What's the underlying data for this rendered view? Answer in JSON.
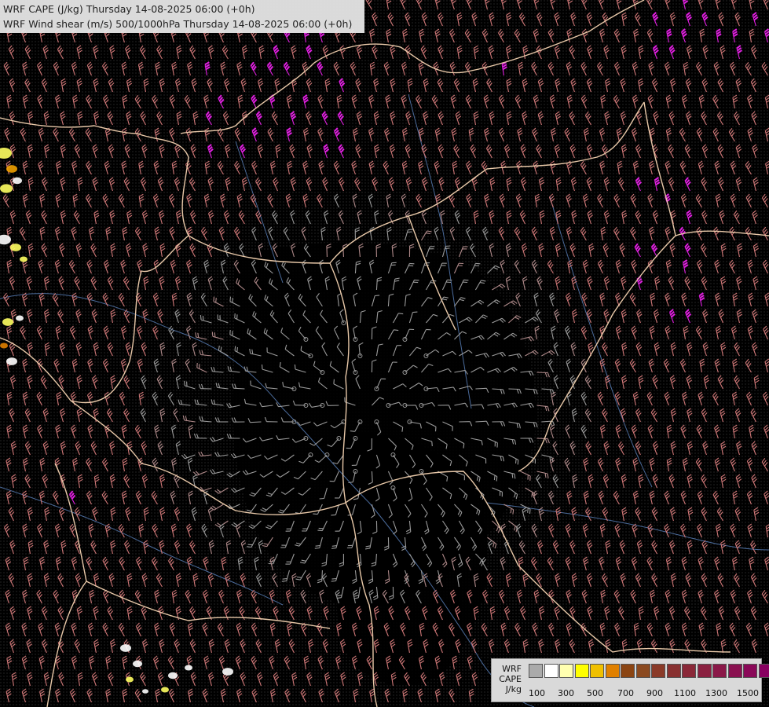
{
  "header": {
    "line1": "WRF CAPE (J/kg) Thursday 14-08-2025 06:00 (+0h)",
    "line2": "WRF Wind shear (m/s) 500/1000hPa Thursday 14-08-2025 06:00 (+0h)"
  },
  "legend": {
    "title_lines": [
      "WRF",
      "CAPE",
      "J/kg"
    ],
    "swatch_colors": [
      "#aaaaaa",
      "#ffffff",
      "#ffffb0",
      "#ffff00",
      "#f0c000",
      "#e08000",
      "#8b4513",
      "#8b4a20",
      "#8a3a28",
      "#883030",
      "#8a2838",
      "#8a2040",
      "#8a1848",
      "#8a1050",
      "#8a0858",
      "#880060"
    ],
    "tick_labels": [
      "100",
      "300",
      "500",
      "700",
      "900",
      "1100",
      "1300",
      "1500"
    ]
  },
  "map_colors": {
    "background": "#000000",
    "border": "#e8c8a8",
    "river": "#4a6a9a",
    "barb_grey": "#9a9a9a",
    "barb_pink": "#d07878",
    "barb_magenta": "#e020e0",
    "cape_yellow": "#ffff60",
    "cape_white": "#ffffff"
  }
}
